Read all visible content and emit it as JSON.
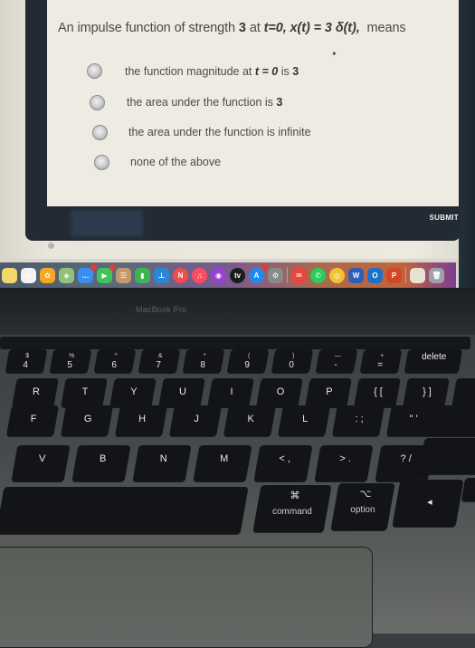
{
  "quiz": {
    "question": {
      "prefix": "An impulse function of strength ",
      "strength": "3",
      "middle": " at ",
      "math": "t=0, x(t) = 3 δ(t),",
      "suffix": "  means"
    },
    "options": [
      {
        "text_before": "the function magnitude at ",
        "math": "t = 0",
        "text_mid": " is ",
        "bold": "3",
        "selected": false
      },
      {
        "text_before": "the area under the function is ",
        "math": "",
        "text_mid": "",
        "bold": "3",
        "selected": false
      },
      {
        "text_before": "the area under the function is infinite",
        "math": "",
        "text_mid": "",
        "bold": "",
        "selected": false
      },
      {
        "text_before": "none of the above",
        "math": "",
        "text_mid": "",
        "bold": "",
        "selected": false
      }
    ],
    "submit_label": "SUBMIT"
  },
  "dock": {
    "icons": [
      {
        "name": "notes-app",
        "color": "#f4d96a",
        "glyph": ""
      },
      {
        "name": "reminders-app",
        "color": "#f2f2f2",
        "glyph": "≡"
      },
      {
        "name": "photos-app",
        "color": "#f5a623",
        "glyph": "✿"
      },
      {
        "name": "maps-app",
        "color": "#8fc27a",
        "glyph": "◈"
      },
      {
        "name": "messages-app",
        "color": "#3b8ef0",
        "glyph": "…",
        "badge": true
      },
      {
        "name": "facetime-app",
        "color": "#41c35a",
        "glyph": "▶",
        "badge": true
      },
      {
        "name": "contacts-app",
        "color": "#c49a6c",
        "glyph": "☰"
      },
      {
        "name": "numbers-app",
        "color": "#3fb34f",
        "glyph": "▮"
      },
      {
        "name": "keynote-app",
        "color": "#2c86d6",
        "glyph": "⊥"
      },
      {
        "name": "news-app",
        "color": "#f24c4c",
        "glyph": "N",
        "round": true
      },
      {
        "name": "music-app",
        "color": "#fa4c62",
        "glyph": "♫",
        "round": true
      },
      {
        "name": "podcasts-app",
        "color": "#9b3fd6",
        "glyph": "◉",
        "round": true
      },
      {
        "name": "apple-tv-app",
        "color": "#1c1c1c",
        "glyph": "tv",
        "round": true
      },
      {
        "name": "app-store-app",
        "color": "#1f8af0",
        "glyph": "A",
        "round": true,
        "badge": true
      },
      {
        "name": "system-preferences-app",
        "color": "#8a8a8a",
        "glyph": "⚙"
      },
      {
        "sep": true
      },
      {
        "name": "mail-app",
        "color": "#e8463c",
        "glyph": "✉"
      },
      {
        "name": "whatsapp-app",
        "color": "#2ecc5a",
        "glyph": "✆",
        "round": true
      },
      {
        "name": "chrome-app",
        "color": "#f2c230",
        "glyph": "◎",
        "round": true
      },
      {
        "name": "word-app",
        "color": "#2b5fb8",
        "glyph": "W"
      },
      {
        "name": "outlook-app",
        "color": "#1a73c9",
        "glyph": "O"
      },
      {
        "name": "powerpoint-app",
        "color": "#d24726",
        "glyph": "P"
      },
      {
        "sep": true
      },
      {
        "name": "documents-folder",
        "color": "#e6e1d3",
        "glyph": ""
      },
      {
        "name": "trash",
        "color": "#9ea3a8",
        "glyph": "🗑"
      }
    ]
  },
  "laptop": {
    "model_label": "MacBook Pro"
  },
  "keyboard": {
    "number_row": [
      {
        "top": "$",
        "bot": "4"
      },
      {
        "top": "%",
        "bot": "5"
      },
      {
        "top": "^",
        "bot": "6"
      },
      {
        "top": "&",
        "bot": "7"
      },
      {
        "top": "*",
        "bot": "8"
      },
      {
        "top": "(",
        "bot": "9"
      },
      {
        "top": ")",
        "bot": "0"
      },
      {
        "top": "—",
        "bot": "-"
      },
      {
        "top": "+",
        "bot": "="
      },
      {
        "top": "",
        "bot": "delete"
      }
    ],
    "top_row": [
      "R",
      "T",
      "Y",
      "U",
      "I",
      "O",
      "P",
      "{ [",
      "} ]"
    ],
    "home_row": [
      "F",
      "G",
      "H",
      "J",
      "K",
      "L",
      ": ;",
      "\" '"
    ],
    "bottom_row": [
      "V",
      "B",
      "N",
      "M",
      "< ,",
      "> .",
      "? /"
    ],
    "command": {
      "symbol": "⌘",
      "label": "command"
    },
    "option": {
      "symbol": "⌥",
      "label": "option"
    },
    "arrow_left": "◂"
  }
}
